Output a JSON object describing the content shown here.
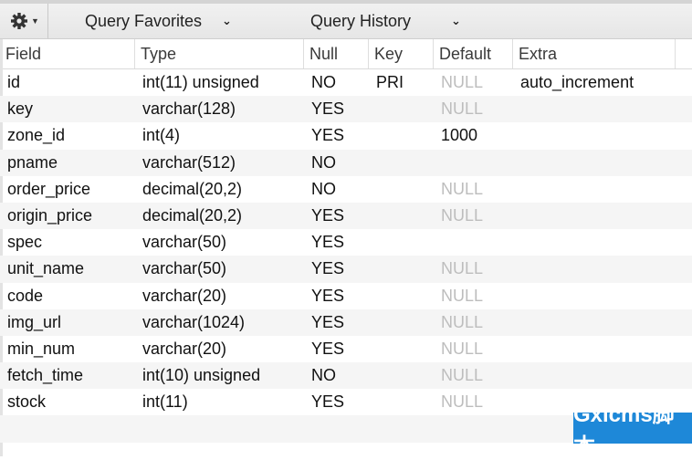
{
  "toolbar": {
    "gear_icon": "gear-icon",
    "menus": [
      {
        "label": "Query Favorites",
        "icon": "chevron-down-icon"
      },
      {
        "label": "Query History",
        "icon": "chevron-down-icon"
      }
    ]
  },
  "table": {
    "columns": [
      "Field",
      "Type",
      "Null",
      "Key",
      "Default",
      "Extra"
    ],
    "rows": [
      {
        "field": "id",
        "type": "int(11) unsigned",
        "null": "NO",
        "key": "PRI",
        "default": "NULL",
        "extra": "auto_increment"
      },
      {
        "field": "key",
        "type": "varchar(128)",
        "null": "YES",
        "key": "",
        "default": "NULL",
        "extra": ""
      },
      {
        "field": "zone_id",
        "type": "int(4)",
        "null": "YES",
        "key": "",
        "default": "1000",
        "extra": ""
      },
      {
        "field": "pname",
        "type": "varchar(512)",
        "null": "NO",
        "key": "",
        "default": "",
        "extra": ""
      },
      {
        "field": "order_price",
        "type": "decimal(20,2)",
        "null": "NO",
        "key": "",
        "default": "NULL",
        "extra": ""
      },
      {
        "field": "origin_price",
        "type": "decimal(20,2)",
        "null": "YES",
        "key": "",
        "default": "NULL",
        "extra": ""
      },
      {
        "field": "spec",
        "type": "varchar(50)",
        "null": "YES",
        "key": "",
        "default": "",
        "extra": ""
      },
      {
        "field": "unit_name",
        "type": "varchar(50)",
        "null": "YES",
        "key": "",
        "default": "NULL",
        "extra": ""
      },
      {
        "field": "code",
        "type": "varchar(20)",
        "null": "YES",
        "key": "",
        "default": "NULL",
        "extra": ""
      },
      {
        "field": "img_url",
        "type": "varchar(1024)",
        "null": "YES",
        "key": "",
        "default": "NULL",
        "extra": ""
      },
      {
        "field": "min_num",
        "type": "varchar(20)",
        "null": "YES",
        "key": "",
        "default": "NULL",
        "extra": ""
      },
      {
        "field": "fetch_time",
        "type": "int(10) unsigned",
        "null": "NO",
        "key": "",
        "default": "NULL",
        "extra": ""
      },
      {
        "field": "stock",
        "type": "int(11)",
        "null": "YES",
        "key": "",
        "default": "NULL",
        "extra": ""
      }
    ]
  },
  "watermark": {
    "text": "Gxlcms脚本",
    "color": "#1e88d8"
  },
  "colors": {
    "null_text": "#bdbdbd",
    "stripe": "#f5f5f5"
  }
}
